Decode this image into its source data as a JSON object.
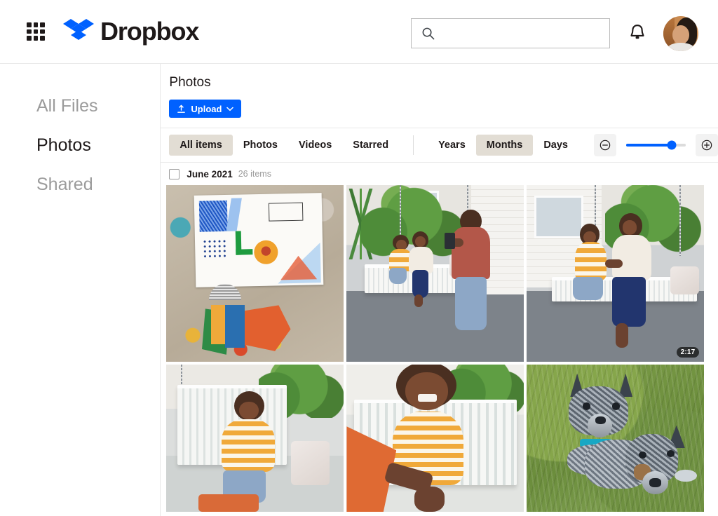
{
  "header": {
    "apps_icon": "apps-grid-icon",
    "logo_icon": "dropbox-logo-icon",
    "brand": "Dropbox",
    "search": {
      "value": "",
      "placeholder": "",
      "icon": "search-icon"
    },
    "bell_icon": "notification-bell-icon",
    "avatar_icon": "user-avatar"
  },
  "sidebar": {
    "items": [
      {
        "label": "All Files",
        "active": false
      },
      {
        "label": "Photos",
        "active": true
      },
      {
        "label": "Shared",
        "active": false
      }
    ]
  },
  "main": {
    "title": "Photos",
    "upload": {
      "label": "Upload",
      "icon": "upload-icon",
      "chevron": "chevron-down-icon",
      "color": "#0061FF"
    }
  },
  "toolbar": {
    "type_filters": [
      {
        "label": "All items",
        "active": true
      },
      {
        "label": "Photos",
        "active": false
      },
      {
        "label": "Videos",
        "active": false
      },
      {
        "label": "Starred",
        "active": false
      }
    ],
    "range_filters": [
      {
        "label": "Years",
        "active": false
      },
      {
        "label": "Months",
        "active": true
      },
      {
        "label": "Days",
        "active": false
      }
    ],
    "zoom": {
      "minus_icon": "zoom-out-icon",
      "plus_icon": "zoom-in-icon",
      "value": 76,
      "accent": "#0061FF"
    },
    "active_pill_color": "#E2DDD4"
  },
  "section": {
    "checkbox_checked": false,
    "date_label": "June 2021",
    "item_count": "26 items"
  },
  "photos": [
    {
      "name": "collage-artwork-photo",
      "row": 1,
      "duration": null
    },
    {
      "name": "porch-swing-photographer-photo",
      "row": 1,
      "duration": null
    },
    {
      "name": "porch-swing-mother-child-video",
      "row": 1,
      "duration": "2:17"
    },
    {
      "name": "child-on-swing-photo",
      "row": 2,
      "duration": null
    },
    {
      "name": "child-reaching-selfie-photo",
      "row": 2,
      "duration": null
    },
    {
      "name": "two-dogs-grass-photo",
      "row": 2,
      "duration": null
    }
  ]
}
